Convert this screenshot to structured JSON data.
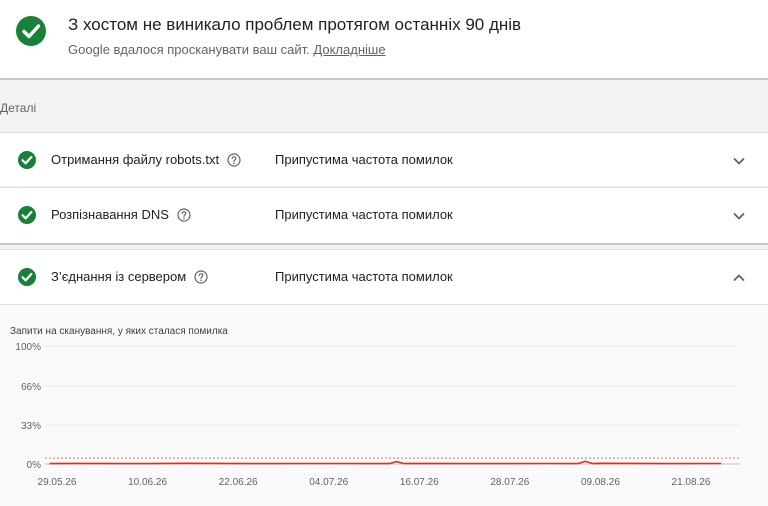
{
  "header": {
    "title": "З хостом не виникало проблем протягом останніх 90 днів",
    "subtitle": "Google вдалося просканувати ваш сайт.",
    "learn_more": "Докладніше",
    "icon": "check-circle-icon",
    "status_color": "#188038"
  },
  "details": {
    "label": "Деталі",
    "rows": [
      {
        "title": "Отримання файлу robots.txt",
        "status": "Припустима частота помилок",
        "expanded": false
      },
      {
        "title": "Розпізнавання DNS",
        "status": "Припустима частота помилок",
        "expanded": false
      },
      {
        "title": "З’єднання із сервером",
        "status": "Припустима частота помилок",
        "expanded": true
      }
    ]
  },
  "chart_data": {
    "type": "line",
    "title": "Запити на сканування, у яких сталася помилка",
    "y_ticks": [
      "100%",
      "66%",
      "33%",
      "0%"
    ],
    "y_tick_values": [
      100,
      66,
      33,
      0
    ],
    "ylim": [
      0,
      100
    ],
    "x_tick_labels": [
      "29.05.26",
      "10.06.26",
      "22.06.26",
      "04.07.26",
      "16.07.26",
      "28.07.26",
      "09.08.26",
      "21.08.26"
    ],
    "threshold": 5,
    "series": [
      {
        "color": "#d93025",
        "x": [
          "28.05.26",
          "01.06.26",
          "10.06.26",
          "15.06.26",
          "24.06.26",
          "03.07.26",
          "12.07.26",
          "13.07.26",
          "14.07.26",
          "15.07.26",
          "22.07.26",
          "01.08.26",
          "06.08.26",
          "07.08.26",
          "08.08.26",
          "09.08.26",
          "18.08.26",
          "25.08.26"
        ],
        "values": [
          0.3,
          0.5,
          0.3,
          0.6,
          0.3,
          0.4,
          0.3,
          2.0,
          0.3,
          0.5,
          0.3,
          0.4,
          0.3,
          2.2,
          0.3,
          0.6,
          0.3,
          0.4
        ]
      }
    ]
  }
}
